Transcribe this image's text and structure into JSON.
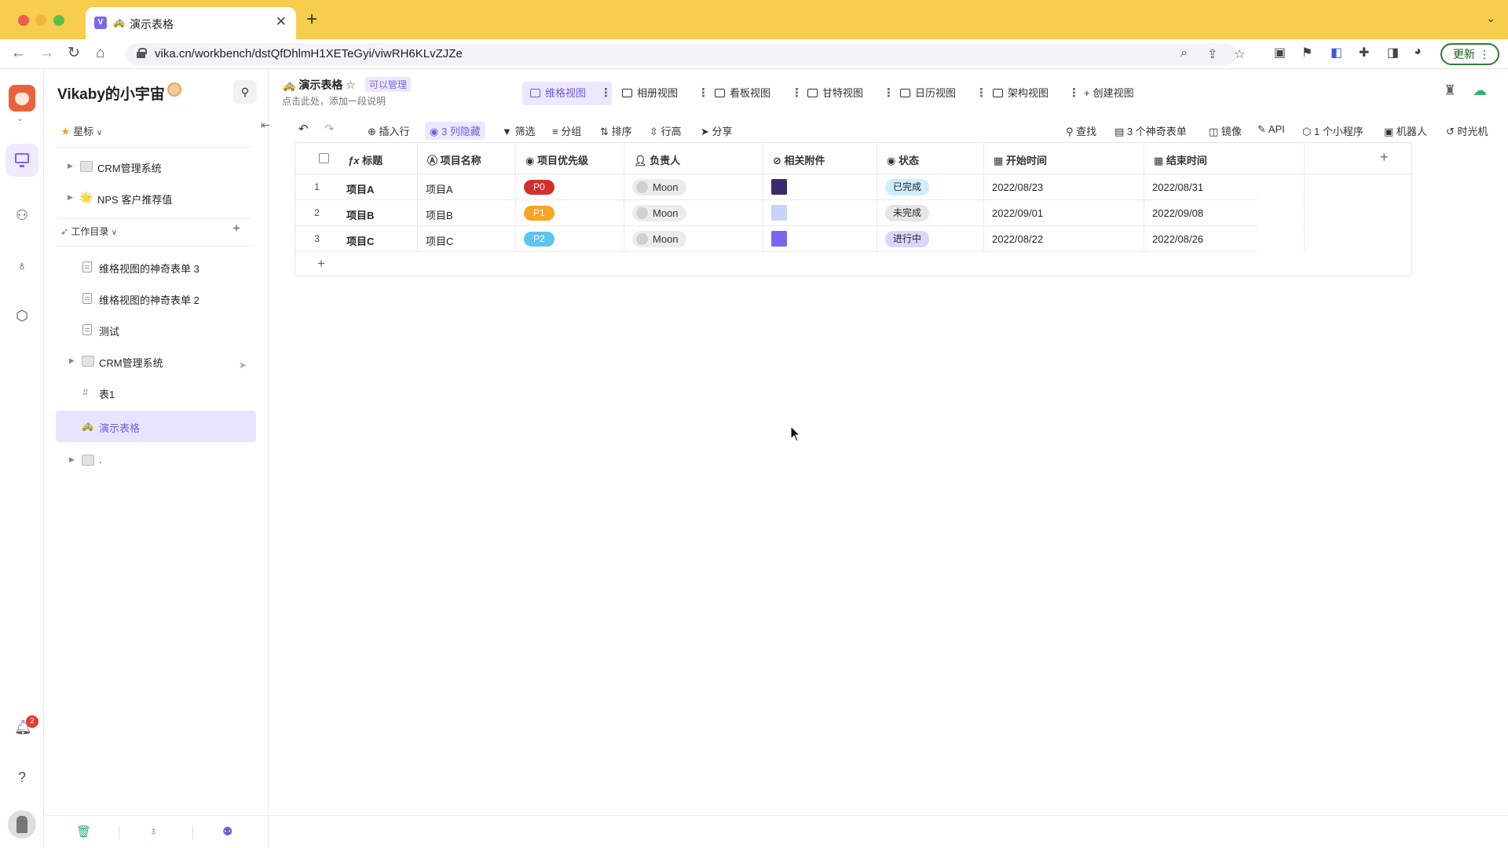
{
  "browser": {
    "tab_title": "演示表格",
    "tab_emoji": "🚕",
    "tab_logo": "V",
    "url": "vika.cn/workbench/dstQfDhlmH1XETeGyi/viwRH6KLvZJZe",
    "update_label": "更新",
    "update_dots": "⋮"
  },
  "rail": {
    "notification_count": "2"
  },
  "sidebar": {
    "space_name": "Vikaby的小宇宙",
    "starred_label": "星标",
    "starred_nodes": [
      {
        "label": "CRM管理系统"
      },
      {
        "label": "NPS 客户推荐值"
      }
    ],
    "workdir_label": "工作目录",
    "nodes": [
      {
        "label": "维格视图的神奇表单 3"
      },
      {
        "label": "维格视图的神奇表单 2"
      },
      {
        "label": "测试"
      },
      {
        "label": "CRM管理系统"
      },
      {
        "label": "表1"
      },
      {
        "label": "演示表格"
      },
      {
        "label": "."
      }
    ]
  },
  "header": {
    "sheet_title": "演示表格",
    "permission": "可以管理",
    "description": "点击此处，添加一段说明",
    "views": [
      {
        "label": "维格视图"
      },
      {
        "label": "相册视图"
      },
      {
        "label": "看板视图"
      },
      {
        "label": "甘特视图"
      },
      {
        "label": "日历视图"
      },
      {
        "label": "架构视图"
      }
    ],
    "create_view": "创建视图"
  },
  "toolbar": {
    "insert_row": "插入行",
    "hidden_cols": "3 列隐藏",
    "filter": "筛选",
    "group": "分组",
    "sort": "排序",
    "row_height": "行高",
    "share": "分享",
    "search": "查找",
    "forms": "3 个神奇表单",
    "mirror": "镜像",
    "api": "API",
    "widgets": "1 个小程序",
    "robot": "机器人",
    "timemachine": "时光机"
  },
  "grid": {
    "columns": [
      "标题",
      "项目名称",
      "项目优先级",
      "负责人",
      "相关附件",
      "状态",
      "开始时间",
      "结束时间"
    ],
    "rows": [
      {
        "num": "1",
        "title": "项目A",
        "name": "项目A",
        "priority": "P0",
        "priority_color": "#d32f2f",
        "owner": "Moon",
        "status": "已完成",
        "status_bg": "#cdeefc",
        "start": "2022/08/23",
        "end": "2022/08/31",
        "attach_color": "#3b2a6d"
      },
      {
        "num": "2",
        "title": "项目B",
        "name": "项目B",
        "priority": "P1",
        "priority_color": "#f6a623",
        "owner": "Moon",
        "status": "未完成",
        "status_bg": "#e6e6e6",
        "start": "2022/09/01",
        "end": "2022/09/08",
        "attach_color": "#c8d4f5"
      },
      {
        "num": "3",
        "title": "项目C",
        "name": "项目C",
        "priority": "P2",
        "priority_color": "#5ec3ef",
        "owner": "Moon",
        "status": "进行中",
        "status_bg": "#dcd6ff",
        "start": "2022/08/22",
        "end": "2022/08/26",
        "attach_color": "#7b67ee"
      }
    ]
  },
  "colors": {
    "accent": "#7b67ee",
    "chrome_bar": "#f6cd4c"
  }
}
